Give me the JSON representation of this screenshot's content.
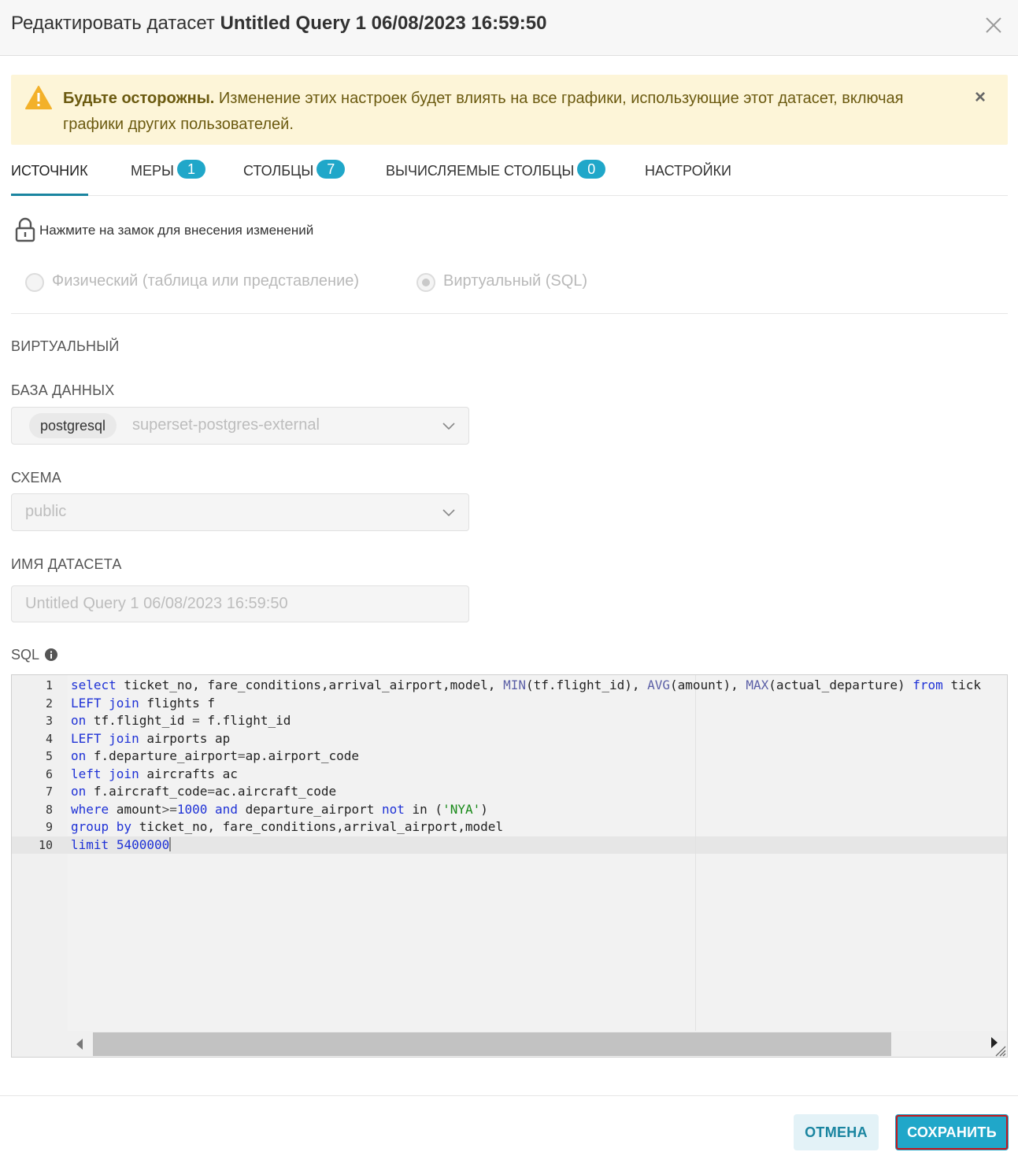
{
  "modal": {
    "title_prefix": "Редактировать датасет",
    "dataset_name": "Untitled Query 1 06/08/2023 16:59:50"
  },
  "alert": {
    "bold_text": "Будьте осторожны.",
    "text": "Изменение этих настроек будет влиять на все графики, использующие этот датасет, включая графики других пользователей."
  },
  "tabs": [
    {
      "label": "ИСТОЧНИК",
      "badge": null,
      "active": true
    },
    {
      "label": "МЕРЫ",
      "badge": "1"
    },
    {
      "label": "СТОЛБЦЫ",
      "badge": "7"
    },
    {
      "label": "ВЫЧИСЛЯЕМЫЕ СТОЛБЦЫ",
      "badge": "0"
    },
    {
      "label": "НАСТРОЙКИ",
      "badge": null
    }
  ],
  "lock": {
    "text": "Нажмите на замок для внесения изменений"
  },
  "source_type": {
    "physical_label": "Физический (таблица или представление)",
    "virtual_label": "Виртуальный (SQL)",
    "selected": "virtual"
  },
  "section": {
    "virtual_heading": "ВИРТУАЛЬНЫЙ"
  },
  "database": {
    "label": "БАЗА ДАННЫХ",
    "tag": "postgresql",
    "value": "superset-postgres-external"
  },
  "schema": {
    "label": "СХЕМА",
    "value": "public"
  },
  "dataset_field": {
    "label": "ИМЯ ДАТАСЕТА",
    "value": "Untitled Query 1 06/08/2023 16:59:50"
  },
  "sql": {
    "label": "SQL",
    "line_numbers": [
      "1",
      "2",
      "3",
      "4",
      "5",
      "6",
      "7",
      "8",
      "9",
      "10"
    ],
    "active_line": 10
  },
  "footer": {
    "cancel_label": "ОТМЕНА",
    "save_label": "СОХРАНИТЬ"
  },
  "colors": {
    "accent": "#20a7c9",
    "alert_bg": "#fdf5d8",
    "warning_icon": "#f3b12a",
    "highlight_outline": "#c4161c",
    "keyword": "#1f32d6",
    "string": "#1a8a1a"
  },
  "icons": {
    "close": "close-icon",
    "warning": "warning-icon",
    "lock": "lock-icon",
    "info": "info-icon",
    "chevron": "chevron-down-icon"
  }
}
